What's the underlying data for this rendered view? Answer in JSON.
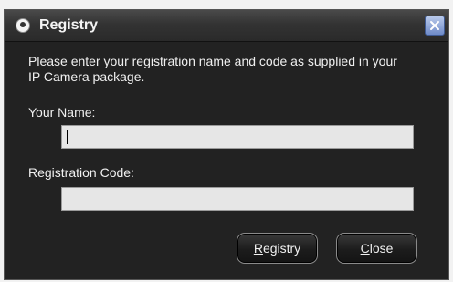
{
  "dialog": {
    "title": "Registry",
    "instructions": "Please enter your registration name and code as supplied in your IP Camera package."
  },
  "name_field": {
    "label": "Your Name:",
    "value": ""
  },
  "code_field": {
    "label": "Registration Code:",
    "value": ""
  },
  "buttons": {
    "registry": {
      "mnemonic": "R",
      "rest": "egistry"
    },
    "close": {
      "mnemonic": "C",
      "rest": "lose"
    }
  },
  "icons": {
    "app": "camera-app-icon",
    "close": "close-icon"
  },
  "colors": {
    "dialog_bg": "#222222",
    "title_text": "#f4f4f4",
    "field_bg": "#e6e6e6",
    "close_button": "#6f8bc9"
  }
}
